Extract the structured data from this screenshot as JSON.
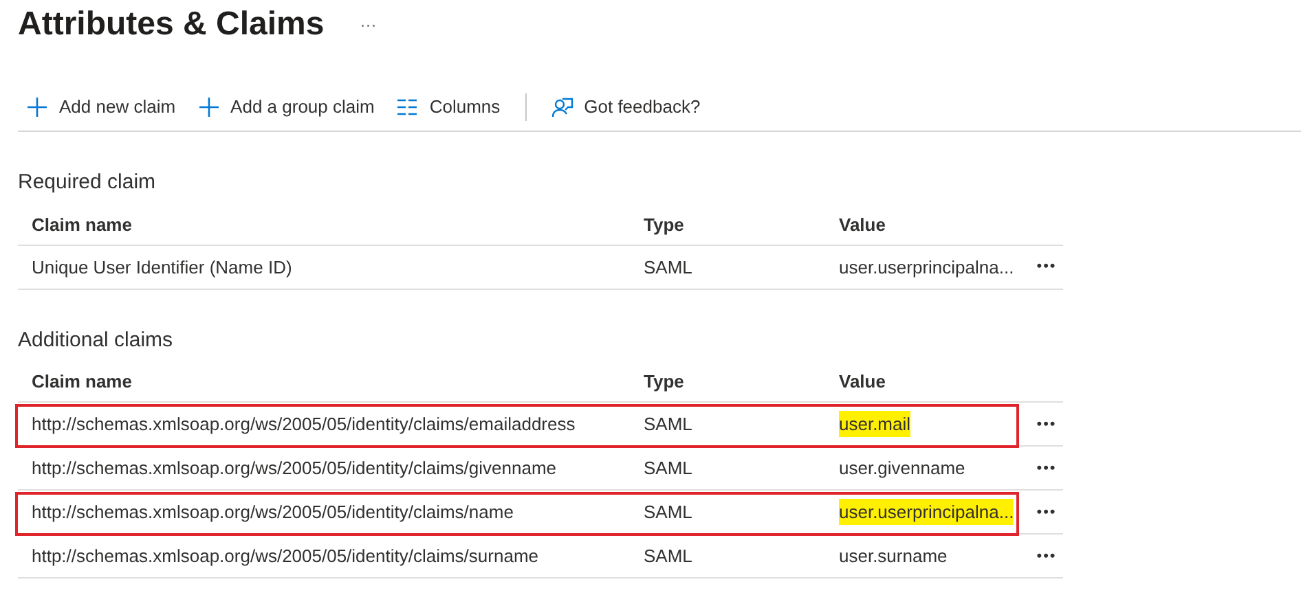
{
  "title": "Attributes & Claims",
  "title_more": "···",
  "toolbar": [
    {
      "kind": "plus",
      "label": "Add new claim"
    },
    {
      "kind": "plus",
      "label": "Add a group claim"
    },
    {
      "kind": "columns",
      "label": "Columns"
    },
    {
      "kind": "feedback",
      "label": "Got feedback?"
    }
  ],
  "sections": [
    {
      "heading": "Required claim",
      "columns": [
        "Claim name",
        "Type",
        "Value"
      ],
      "rows": [
        {
          "name": "Unique User Identifier (Name ID)",
          "type": "SAML",
          "value": "user.userprincipalna...",
          "highlighted": false,
          "value_marked": false,
          "more": "•••"
        }
      ]
    },
    {
      "heading": "Additional claims",
      "columns": [
        "Claim name",
        "Type",
        "Value"
      ],
      "rows": [
        {
          "name": "http://schemas.xmlsoap.org/ws/2005/05/identity/claims/emailaddress",
          "type": "SAML",
          "value": "user.mail",
          "highlighted": true,
          "value_marked": true,
          "more": "•••"
        },
        {
          "name": "http://schemas.xmlsoap.org/ws/2005/05/identity/claims/givenname",
          "type": "SAML",
          "value": "user.givenname",
          "highlighted": false,
          "value_marked": false,
          "more": "•••"
        },
        {
          "name": "http://schemas.xmlsoap.org/ws/2005/05/identity/claims/name",
          "type": "SAML",
          "value": "user.userprincipalna...",
          "highlighted": true,
          "value_marked": true,
          "more": "•••"
        },
        {
          "name": "http://schemas.xmlsoap.org/ws/2005/05/identity/claims/surname",
          "type": "SAML",
          "value": "user.surname",
          "highlighted": false,
          "value_marked": false,
          "more": "•••"
        }
      ]
    }
  ]
}
